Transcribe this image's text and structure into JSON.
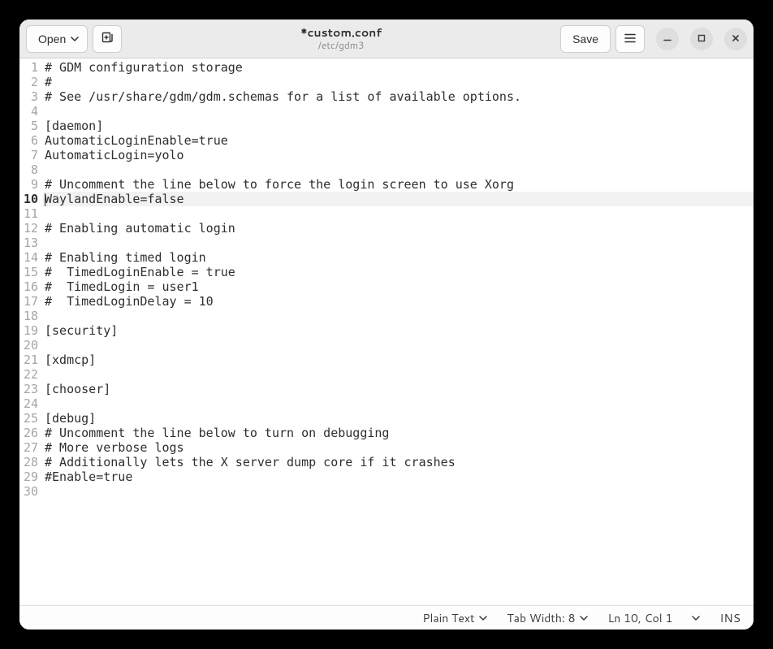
{
  "header": {
    "open_label": "Open",
    "save_label": "Save",
    "title": "*custom.conf",
    "subtitle": "/etc/gdm3"
  },
  "editor": {
    "current_line": 10,
    "lines": [
      "# GDM configuration storage",
      "#",
      "# See /usr/share/gdm/gdm.schemas for a list of available options.",
      "",
      "[daemon]",
      "AutomaticLoginEnable=true",
      "AutomaticLogin=yolo",
      "",
      "# Uncomment the line below to force the login screen to use Xorg",
      "WaylandEnable=false",
      "",
      "# Enabling automatic login",
      "",
      "# Enabling timed login",
      "#  TimedLoginEnable = true",
      "#  TimedLogin = user1",
      "#  TimedLoginDelay = 10",
      "",
      "[security]",
      "",
      "[xdmcp]",
      "",
      "[chooser]",
      "",
      "[debug]",
      "# Uncomment the line below to turn on debugging",
      "# More verbose logs",
      "# Additionally lets the X server dump core if it crashes",
      "#Enable=true",
      ""
    ]
  },
  "statusbar": {
    "syntax": "Plain Text",
    "tabwidth": "Tab Width: 8",
    "position": "Ln 10, Col 1",
    "insert_mode": "INS"
  }
}
